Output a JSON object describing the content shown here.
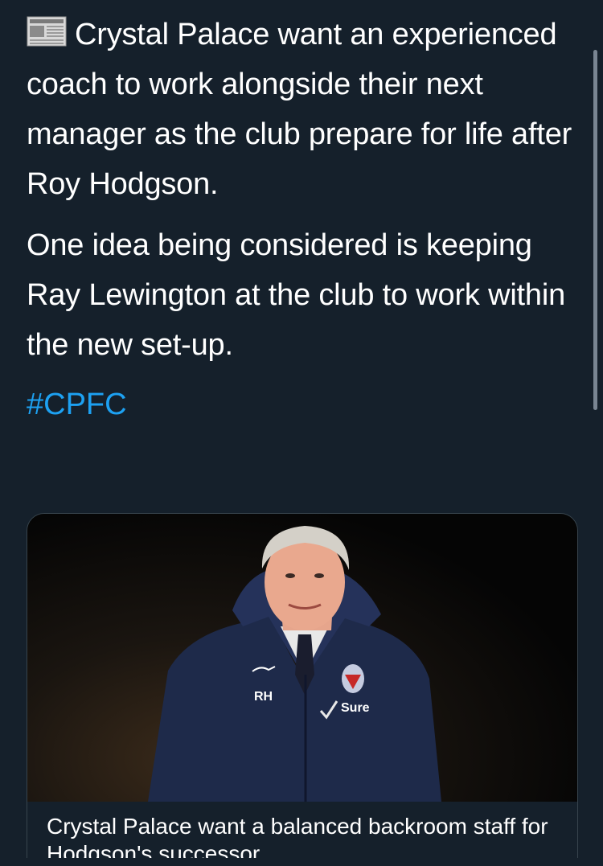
{
  "tweet": {
    "paragraph1": "Crystal Palace want an experienced coach to work alongside their next manager as the club prepare for life after Roy Hodgson.",
    "paragraph2": "One idea being considered is keeping Ray Lewington at the club to work within the new set-up.",
    "hashtag": "#CPFC",
    "hashtag_color": "#1da1f2",
    "leading_icon": "newspaper-icon"
  },
  "card": {
    "image_label": "photo of Roy Hodgson in Crystal Palace coat",
    "image_text_initials": "RH",
    "image_text_sponsor": "Sure",
    "title": "Crystal Palace want a balanced backroom staff for Hodgson's successor"
  },
  "theme": {
    "background": "#15202b",
    "text": "#ffffff",
    "border": "#38444d"
  }
}
